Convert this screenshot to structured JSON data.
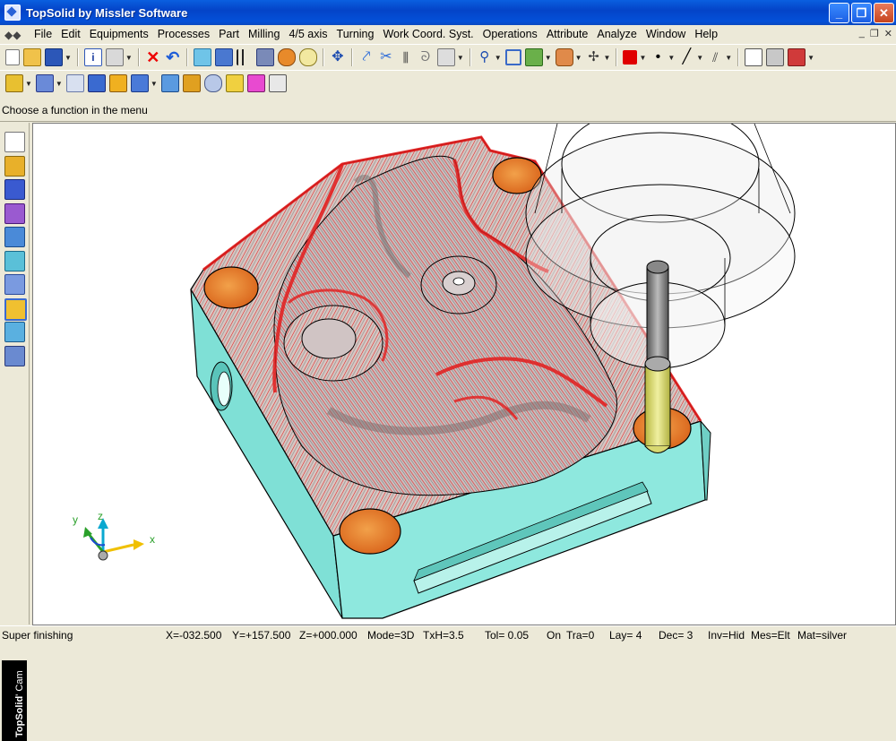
{
  "window": {
    "title": "TopSolid by Missler Software",
    "buttons": [
      "_",
      "❐",
      "✕"
    ]
  },
  "menubar": {
    "items": [
      "File",
      "Edit",
      "Equipments",
      "Processes",
      "Part",
      "Milling",
      "4/5 axis",
      "Turning",
      "Work Coord. Syst.",
      "Operations",
      "Attribute",
      "Analyze",
      "Window",
      "Help"
    ],
    "mdi_buttons": [
      "_",
      "❐",
      "✕"
    ]
  },
  "prompt": {
    "text": "Choose a function in the menu"
  },
  "sidebar": {
    "brand": "TopSolid",
    "app": "' Cam"
  },
  "status": {
    "mode_text": "Super finishing",
    "x": "X=-032.500",
    "y": "Y=+157.500",
    "z": "Z=+000.000",
    "mode": "Mode=3D",
    "txh": "TxH=3.5",
    "tol": "Tol=  0.05",
    "on": "On",
    "tra": "Tra=0",
    "lay": "Lay=  4",
    "dec": "Dec= 3",
    "inv": "Inv=Hid",
    "mes": "Mes=Elt",
    "mat": "Mat=silver"
  },
  "triad": {
    "x": "x",
    "y": "y",
    "z": "z"
  },
  "colors": {
    "title_bar": "#0450d8",
    "part": "#7ee0d6",
    "toolpath": "#e31b1b",
    "tool_holder": "#e8e8e8",
    "tool": "#d8d870",
    "clamp_pads": "#e67a22"
  },
  "icons": {
    "toolbar1": [
      "new-icon",
      "open-icon",
      "save-icon",
      "info-icon",
      "print-icon",
      "delete-icon",
      "undo-icon",
      "refresh-icon",
      "measure-icon",
      "params-icon",
      "tool-icon",
      "material-icon",
      "setup-icon",
      "cursor-icon",
      "toolpath-icon",
      "cut-icon",
      "axis-icon",
      "hook-icon",
      "turning-icon",
      "zoom-icon",
      "fit-icon",
      "view-icon",
      "layer-icon",
      "target-icon",
      "color-icon",
      "point-icon",
      "line-icon",
      "hatch-icon",
      "doc-icon",
      "shading-icon",
      "machine-icon"
    ],
    "toolbar2": [
      "operation-icon",
      "stock-icon",
      "sheet-icon",
      "pocket-icon",
      "contour-icon",
      "drill-icon",
      "surface-icon",
      "finish-icon",
      "probe-icon",
      "wear-icon",
      "3d-icon",
      "simulate-icon"
    ],
    "left": [
      "sketch-icon",
      "curve-icon",
      "shape-icon",
      "draft-icon",
      "assembly-icon",
      "electrode-icon",
      "cam-icon",
      "mold-icon",
      "family-icon",
      "machine-icon"
    ]
  }
}
